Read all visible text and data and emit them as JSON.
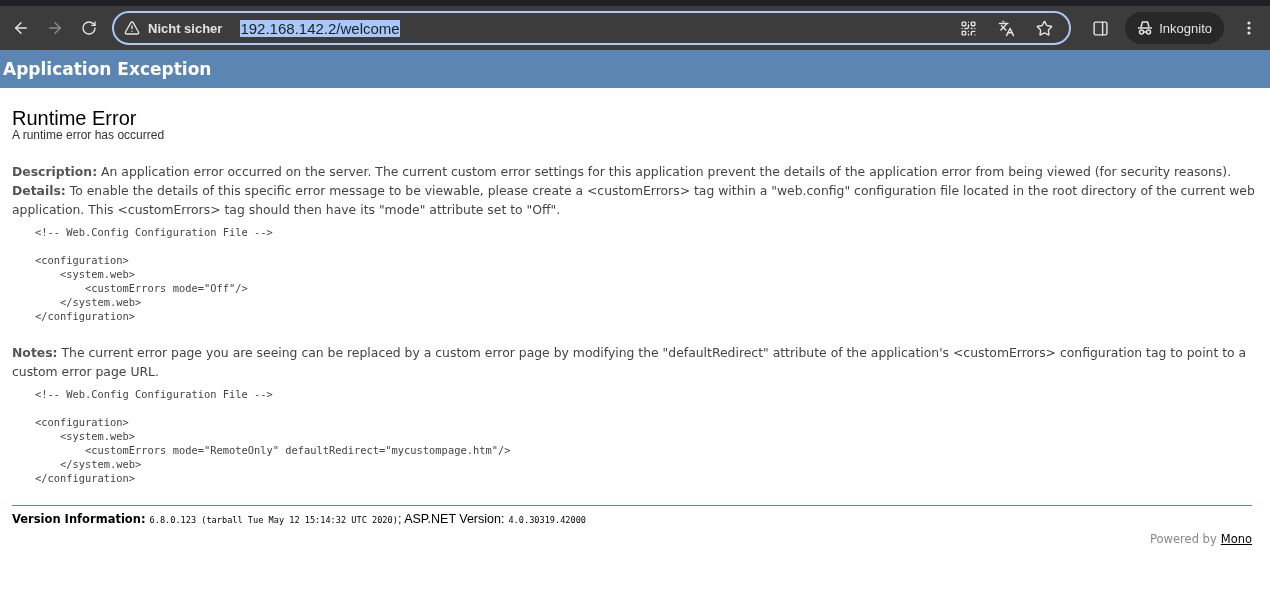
{
  "browser": {
    "security_label": "Nicht sicher",
    "url": "192.168.142.2/welcome",
    "url_selected": true,
    "profile_label": "Inkognito"
  },
  "header": {
    "title": "Application Exception"
  },
  "error": {
    "title": "Runtime Error",
    "subtitle": "A runtime error has occurred"
  },
  "sections": [
    {
      "kind": "text",
      "text": "**Description:** An application error occurred on the server. The current custom error settings for this application prevent the details of the application error from being viewed (for security reasons)."
    },
    {
      "kind": "text",
      "text": "**Details:** To enable the details of this specific error message to be viewable, please create a <customErrors> tag within a \"web.config\" configuration file located in the root directory of the current web application. This <customErrors> tag should then have its \"mode\" attribute set to \"Off\"."
    },
    {
      "kind": "code",
      "text": "<!-- Web.Config Configuration File -->\n\n<configuration>\n    <system.web>\n        <customErrors mode=\"Off\"/>\n    </system.web>\n</configuration>"
    },
    {
      "kind": "text",
      "text": "**Notes:** The current error page you are seeing can be replaced by a custom error page by modifying the \"defaultRedirect\" attribute of the application's <customErrors> configuration tag to point to a custom error page URL."
    },
    {
      "kind": "code",
      "text": "<!-- Web.Config Configuration File -->\n\n<configuration>\n    <system.web>\n        <customErrors mode=\"RemoteOnly\" defaultRedirect=\"mycustompage.htm\"/>\n    </system.web>\n</configuration>"
    }
  ],
  "version": {
    "label": "Version Information:",
    "mono_version": "6.8.0.123 (tarball Tue May 12 15:14:32 UTC 2020)",
    "aspnet_label": "; ASP.NET Version:",
    "aspnet_version": "4.0.30319.42000"
  },
  "footer": {
    "powered_by": "Powered by",
    "link": "Mono"
  }
}
